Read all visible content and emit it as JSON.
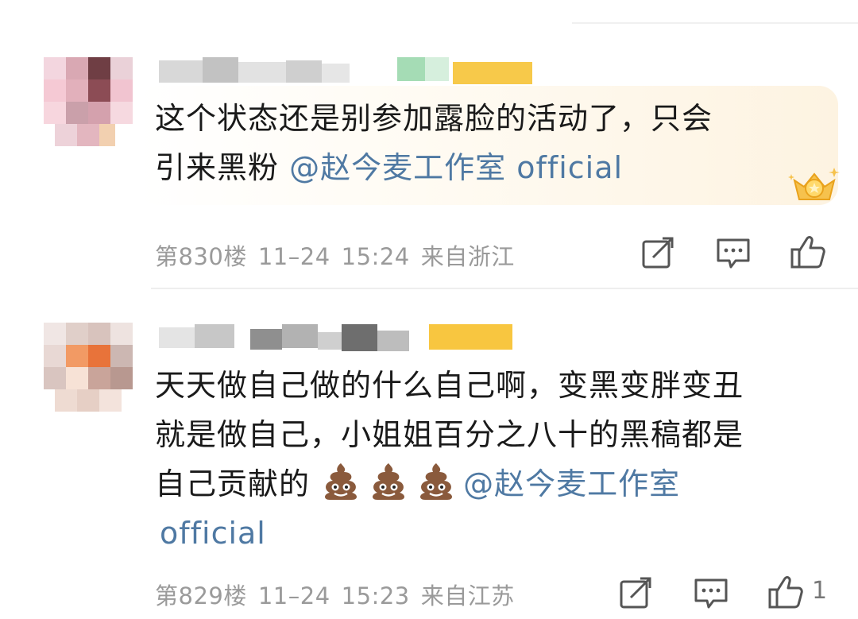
{
  "comments": [
    {
      "text_lines": [
        "这个状态还是别参加露脸的活动了，只会",
        "引来黑粉"
      ],
      "mention": "@赵今麦工作室 official",
      "floor": "第830楼",
      "date": "11–24",
      "time": "15:24",
      "location": "来自浙江",
      "badge_icon": "crown-star-badge-icon"
    },
    {
      "text_lines": [
        "天天做自己做的什么自己啊，变黑变胖变丑",
        "就是做自己，小姐姐百分之八十的黑稿都是",
        "自己贡献的"
      ],
      "emoji": "poop-emoji",
      "emoji_count": 3,
      "mention_line3": "@赵今麦工作室",
      "mention_line4": "official",
      "floor": "第829楼",
      "date": "11–24",
      "time": "15:23",
      "location": "来自江苏",
      "likes": "1"
    }
  ],
  "icons": [
    "share-icon",
    "reply-icon",
    "like-icon"
  ],
  "colors": {
    "mention": "#4f79a3",
    "meta": "#9a9a9a",
    "highlight": "#fdf3e1"
  }
}
